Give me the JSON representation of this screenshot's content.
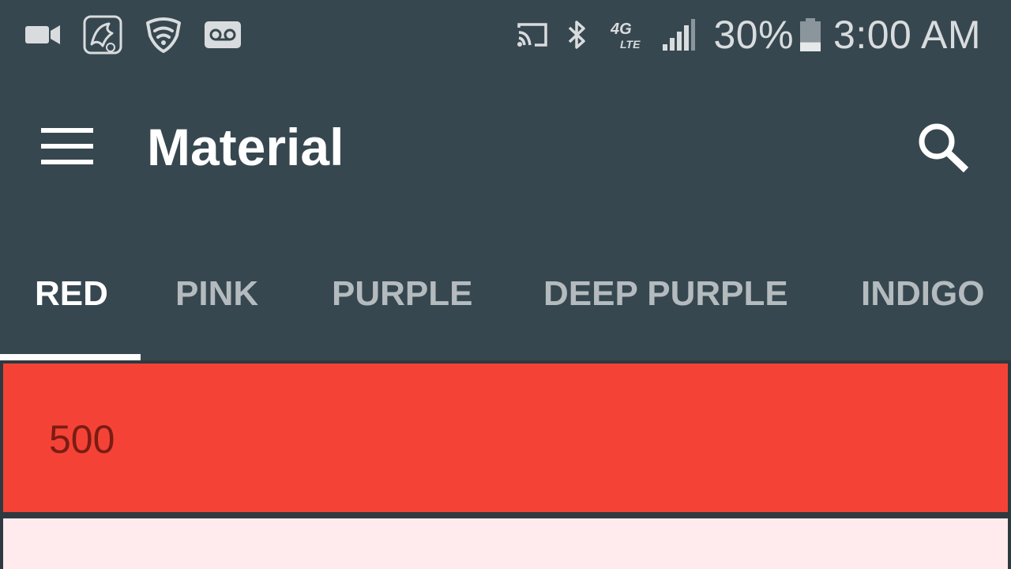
{
  "status_bar": {
    "icons_left": [
      "video-camera-icon",
      "stylized-app-icon",
      "wifi-shield-icon",
      "voicemail-icon"
    ],
    "icons_right": [
      "cast-icon",
      "bluetooth-icon",
      "4g-lte-icon",
      "signal-icon",
      "battery-icon"
    ],
    "network_label": "4G",
    "network_sub": "LTE",
    "battery_percent": "30%",
    "battery_level": 0.3,
    "time": "3:00 AM"
  },
  "app_bar": {
    "title": "Material",
    "menu_icon": "hamburger-menu-icon",
    "search_icon": "search-icon",
    "background": "#37474F"
  },
  "tabs": {
    "items": [
      {
        "label": "RED",
        "active": true
      },
      {
        "label": "PINK",
        "active": false
      },
      {
        "label": "PURPLE",
        "active": false
      },
      {
        "label": "DEEP PURPLE",
        "active": false
      },
      {
        "label": "INDIGO",
        "active": false
      }
    ],
    "indicator_color": "#FFFFFF"
  },
  "swatches": [
    {
      "label": "500",
      "color": "#F44336"
    },
    {
      "label": "",
      "color": "#FFEBEE"
    }
  ]
}
